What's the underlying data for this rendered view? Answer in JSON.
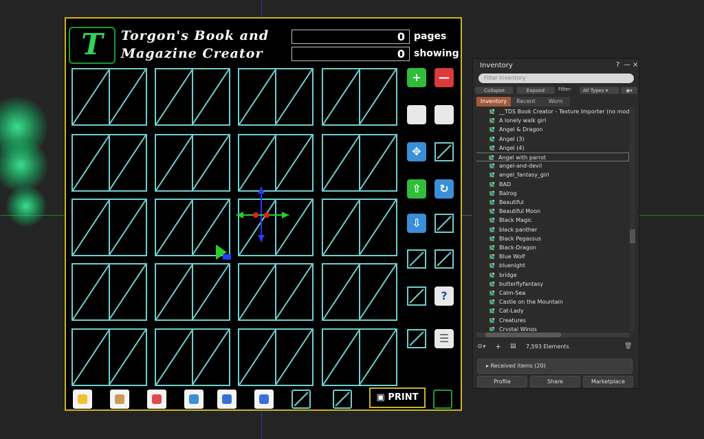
{
  "creator": {
    "title_line1": "Torgon's Book and",
    "title_line2": "Magazine Creator",
    "logo_text": "T",
    "pages_count": "0",
    "pages_label": "pages",
    "showing_count": "0",
    "showing_label": "showing",
    "print_label": "PRINT",
    "side_buttons": [
      "plus-icon",
      "minus-icon",
      "prev-icon",
      "next-icon",
      "expand-icon",
      "empty-slot",
      "up-arrow-icon",
      "refresh-icon",
      "down-arrow-icon",
      "empty-slot",
      "empty-slot",
      "empty-slot",
      "empty-slot",
      "help-icon",
      "empty-slot",
      "list-icon"
    ],
    "bottom_buttons": [
      "pen-icon",
      "box-icon",
      "shop-icon",
      "globe-icon",
      "list-icon",
      "chart-icon",
      "empty-slot",
      "empty-slot"
    ]
  },
  "inventory": {
    "title": "Inventory",
    "help_glyph": "?",
    "minimize_glyph": "—",
    "close_glyph": "×",
    "filter_placeholder": "Filter Inventory",
    "collapse_label": "Collapse",
    "expand_label": "Expand",
    "filter_label": "Filter:",
    "filter_value": "All Types",
    "tabs": [
      "Inventory",
      "Recent",
      "Worn"
    ],
    "items": [
      "__TDS Book Creator - Texture Importer (no mod",
      "A lonely walk girl",
      "Angel & Dragon",
      "Angel (3)",
      "Angel (4)",
      "Angel with parrot",
      "angel-and-devil",
      "angel_fantasy_girl",
      "BAD",
      "Balrog",
      "Beautiful",
      "Beautiful Moon",
      "Black Magic",
      "black panther",
      "Black Pegassus",
      "Black-Dragon",
      "Blue Wolf",
      "bluenight",
      "bridge",
      "butterflyfantasy",
      "Calm-Sea",
      "Castle on the Mountain",
      "Cat-Lady",
      "Creatures",
      "Crystal Wings"
    ],
    "selected_item": "Angel with parrot",
    "elements_count": "7,593 Elements",
    "received_label": "Received items (20)",
    "profile_label": "Profile",
    "share_label": "Share",
    "marketplace_label": "Marketplace"
  }
}
